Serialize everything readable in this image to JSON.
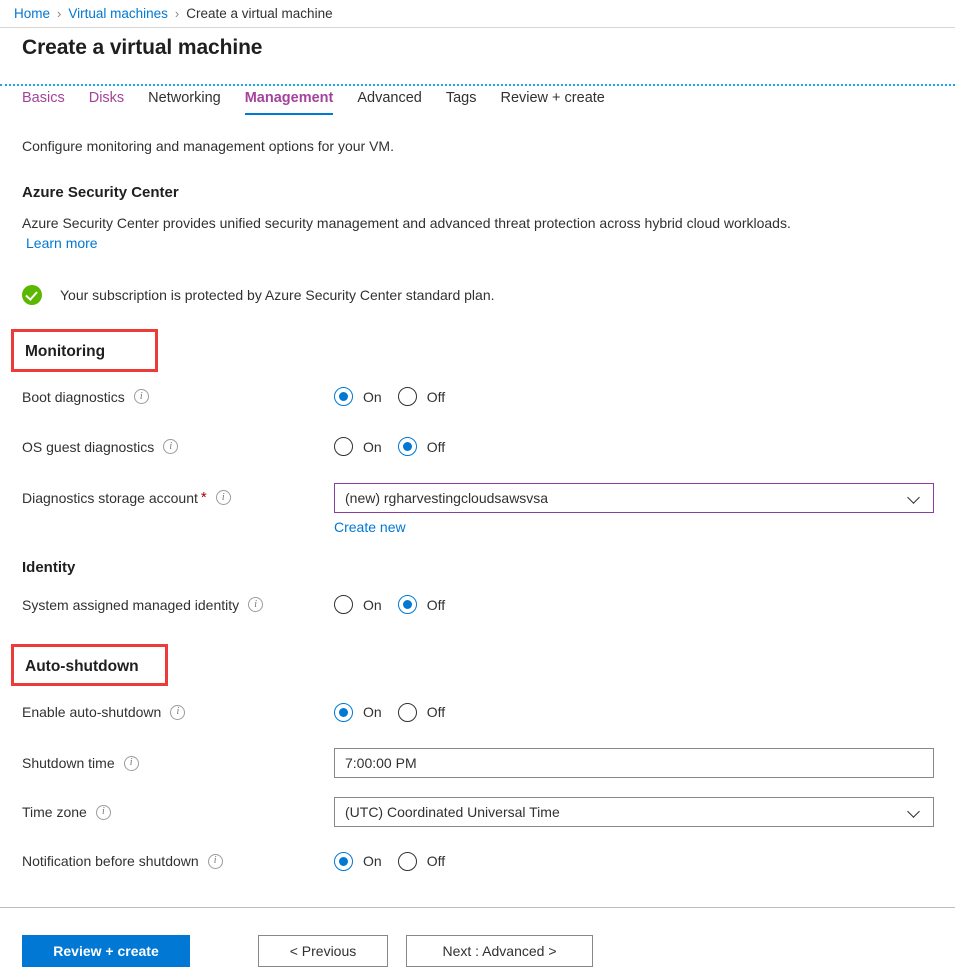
{
  "breadcrumb": {
    "items": [
      {
        "label": "Home",
        "type": "link"
      },
      {
        "label": "Virtual machines",
        "type": "link"
      },
      {
        "label": "Create a virtual machine",
        "type": "current"
      }
    ],
    "separator": "›"
  },
  "page": {
    "title": "Create a virtual machine"
  },
  "tabs": [
    {
      "label": "Basics",
      "state": "visited"
    },
    {
      "label": "Disks",
      "state": "visited"
    },
    {
      "label": "Networking",
      "state": "default"
    },
    {
      "label": "Management",
      "state": "active"
    },
    {
      "label": "Advanced",
      "state": "default"
    },
    {
      "label": "Tags",
      "state": "default"
    },
    {
      "label": "Review + create",
      "state": "default"
    }
  ],
  "main": {
    "intro": "Configure monitoring and management options for your VM.",
    "security_center": {
      "heading": "Azure Security Center",
      "description": "Azure Security Center provides unified security management and advanced threat protection across hybrid cloud workloads.",
      "learn_more": "Learn more",
      "status_text": "Your subscription is protected by Azure Security Center standard plan.",
      "status_color": "#5bb700"
    },
    "monitoring": {
      "heading": "Monitoring",
      "highlight_color": "#ec3b38",
      "boot_diagnostics": {
        "label": "Boot diagnostics",
        "on_label": "On",
        "off_label": "Off",
        "value": "On"
      },
      "os_guest_diagnostics": {
        "label": "OS guest diagnostics",
        "on_label": "On",
        "off_label": "Off",
        "value": "Off"
      },
      "diagnostics_storage_account": {
        "label": "Diagnostics storage account",
        "required_mark": "*",
        "value": "(new) rgharvestingcloudsawsvsa",
        "create_new_label": "Create new"
      }
    },
    "identity": {
      "heading": "Identity",
      "system_assigned": {
        "label": "System assigned managed identity",
        "on_label": "On",
        "off_label": "Off",
        "value": "Off"
      }
    },
    "auto_shutdown": {
      "heading": "Auto-shutdown",
      "highlight_color": "#ec3b38",
      "enable": {
        "label": "Enable auto-shutdown",
        "on_label": "On",
        "off_label": "Off",
        "value": "On"
      },
      "shutdown_time": {
        "label": "Shutdown time",
        "value": "7:00:00 PM"
      },
      "time_zone": {
        "label": "Time zone",
        "value": "(UTC) Coordinated Universal Time"
      },
      "notification": {
        "label": "Notification before shutdown",
        "on_label": "On",
        "off_label": "Off",
        "value": "On"
      }
    }
  },
  "footer": {
    "review_create": "Review + create",
    "previous": "< Previous",
    "next": "Next : Advanced >"
  },
  "colors": {
    "accent": "#0078d4",
    "visited_tab": "#a4439b",
    "highlight": "#ec3b38",
    "success": "#5bb700",
    "required": "#a80000"
  }
}
